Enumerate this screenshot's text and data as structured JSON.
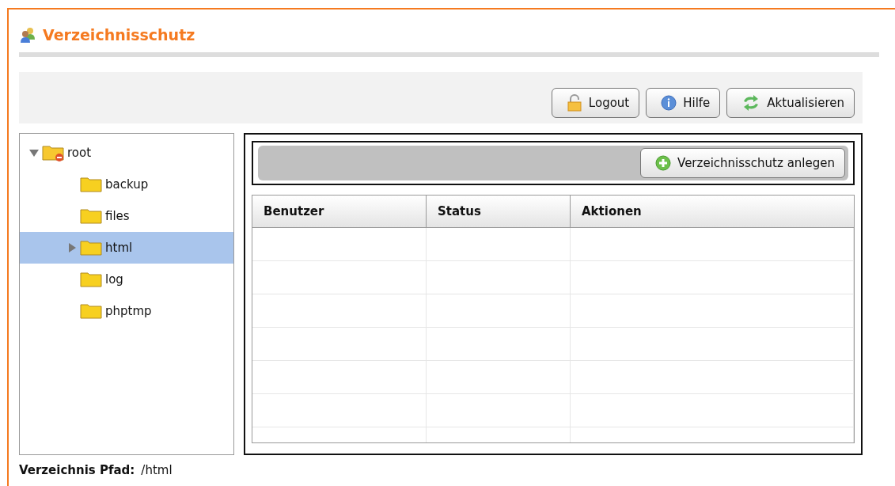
{
  "title": "Verzeichnisschutz",
  "toolbar": [
    {
      "kind": "lock",
      "label": "Logout"
    },
    {
      "kind": "info",
      "label": "Hilfe"
    },
    {
      "kind": "refresh",
      "label": "Aktualisieren"
    }
  ],
  "tree": [
    {
      "label": "root",
      "kind": "root",
      "expanded": true,
      "selected": false,
      "children": [
        {
          "label": "backup",
          "kind": "folder",
          "selected": false
        },
        {
          "label": "files",
          "kind": "folder",
          "selected": false
        },
        {
          "label": "html",
          "kind": "folder",
          "expanded": false,
          "selected": true
        },
        {
          "label": "log",
          "kind": "folder",
          "selected": false
        },
        {
          "label": "phptmp",
          "kind": "folder",
          "selected": false
        }
      ]
    }
  ],
  "add_button": {
    "label": "Verzeichnisschutz anlegen"
  },
  "table": {
    "columns": [
      "Benutzer",
      "Status",
      "Aktionen"
    ]
  },
  "footer": {
    "label": "Verzeichnis Pfad:",
    "value": "/html"
  }
}
